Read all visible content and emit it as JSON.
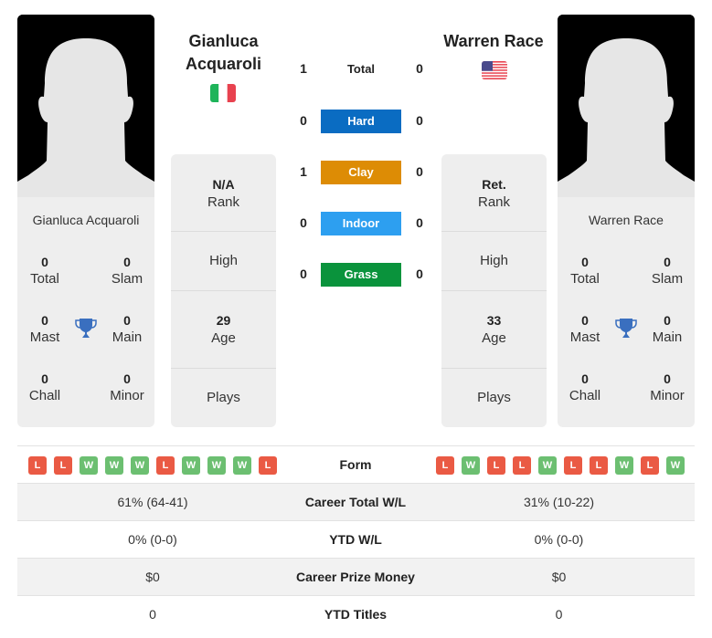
{
  "colors": {
    "hard": "#0a6cc2",
    "clay": "#dd8c05",
    "indoor": "#2d9ff0",
    "grass": "#0a933c",
    "win": "#6cbf71",
    "loss": "#ea5a44",
    "trophy": "#3a6fbf"
  },
  "player1": {
    "name": "Gianluca Acquaroli",
    "name_line1": "Gianluca",
    "name_line2": "Acquaroli",
    "flag": "italy-flag",
    "card_name": "Gianluca Acquaroli",
    "titles": {
      "total": {
        "value": "0",
        "label": "Total"
      },
      "slam": {
        "value": "0",
        "label": "Slam"
      },
      "mast": {
        "value": "0",
        "label": "Mast"
      },
      "main": {
        "value": "0",
        "label": "Main"
      },
      "chall": {
        "value": "0",
        "label": "Chall"
      },
      "minor": {
        "value": "0",
        "label": "Minor"
      }
    },
    "info": {
      "rank_value": "N/A",
      "rank_label": "Rank",
      "high_label": "High",
      "age_value": "29",
      "age_label": "Age",
      "plays_label": "Plays"
    },
    "form": [
      "L",
      "L",
      "W",
      "W",
      "W",
      "L",
      "W",
      "W",
      "W",
      "L"
    ]
  },
  "player2": {
    "name": "Warren Race",
    "flag": "usa-flag",
    "card_name": "Warren Race",
    "titles": {
      "total": {
        "value": "0",
        "label": "Total"
      },
      "slam": {
        "value": "0",
        "label": "Slam"
      },
      "mast": {
        "value": "0",
        "label": "Mast"
      },
      "main": {
        "value": "0",
        "label": "Main"
      },
      "chall": {
        "value": "0",
        "label": "Chall"
      },
      "minor": {
        "value": "0",
        "label": "Minor"
      }
    },
    "info": {
      "rank_value": "Ret.",
      "rank_label": "Rank",
      "high_label": "High",
      "age_value": "33",
      "age_label": "Age",
      "plays_label": "Plays"
    },
    "form": [
      "L",
      "W",
      "L",
      "L",
      "W",
      "L",
      "L",
      "W",
      "L",
      "W"
    ]
  },
  "h2h": [
    {
      "label": "Total",
      "left": "1",
      "right": "0",
      "key": "total"
    },
    {
      "label": "Hard",
      "left": "0",
      "right": "0",
      "key": "hard"
    },
    {
      "label": "Clay",
      "left": "1",
      "right": "0",
      "key": "clay"
    },
    {
      "label": "Indoor",
      "left": "0",
      "right": "0",
      "key": "indoor"
    },
    {
      "label": "Grass",
      "left": "0",
      "right": "0",
      "key": "grass"
    }
  ],
  "table": {
    "form_label": "Form",
    "rows": [
      {
        "label": "Career Total W/L",
        "left": "61% (64-41)",
        "right": "31% (10-22)"
      },
      {
        "label": "YTD W/L",
        "left": "0% (0-0)",
        "right": "0% (0-0)"
      },
      {
        "label": "Career Prize Money",
        "left": "$0",
        "right": "$0"
      },
      {
        "label": "YTD Titles",
        "left": "0",
        "right": "0"
      }
    ]
  }
}
